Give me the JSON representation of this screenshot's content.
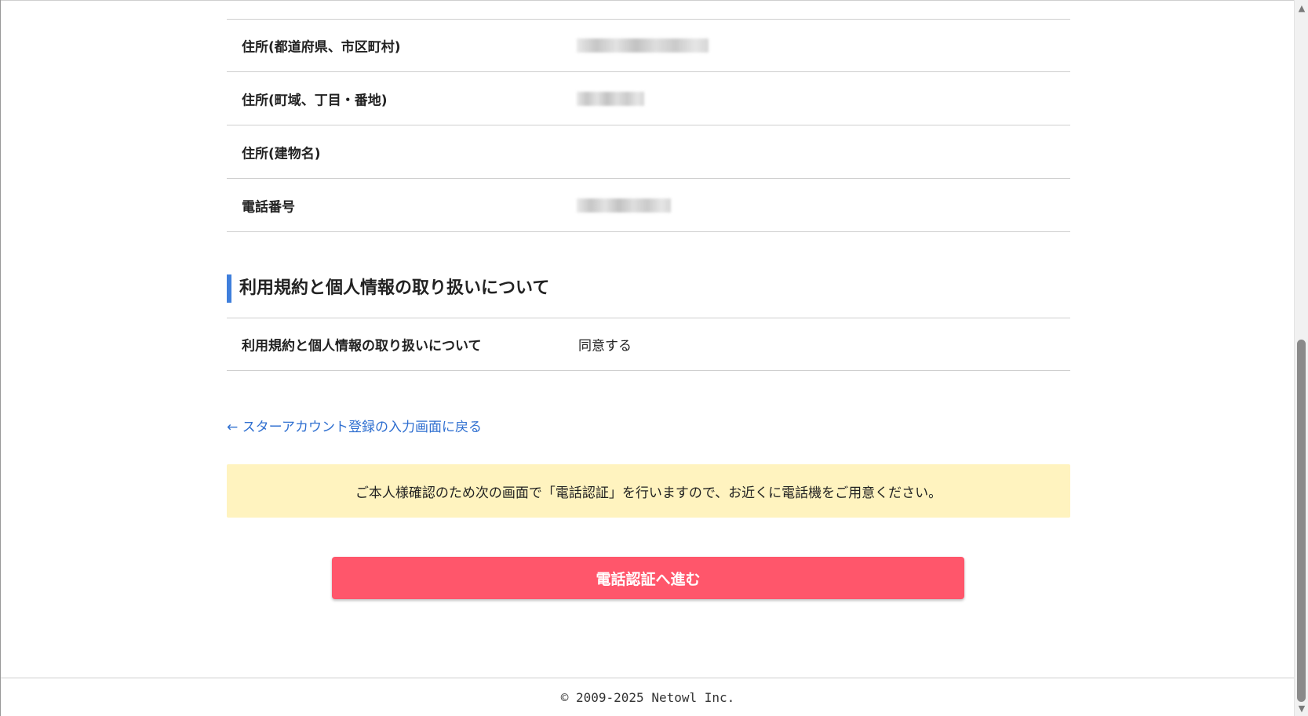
{
  "address_rows": [
    {
      "label": "住所(都道府県、市区町村)",
      "value": "",
      "redacted": true
    },
    {
      "label": "住所(町域、丁目・番地)",
      "value": "",
      "redacted": true
    },
    {
      "label": "住所(建物名)",
      "value": "",
      "redacted": false
    },
    {
      "label": "電話番号",
      "value": "",
      "redacted": true
    }
  ],
  "terms_section": {
    "title": "利用規約と個人情報の取り扱いについて",
    "row": {
      "label": "利用規約と個人情報の取り扱いについて",
      "value": "同意する"
    }
  },
  "back_link": {
    "arrow": "←",
    "label": "スターアカウント登録の入力画面に戻る"
  },
  "notice": "ご本人様確認のため次の画面で「電話認証」を行いますので、お近くに電話機をご用意ください。",
  "submit_label": "電話認証へ進む",
  "footer": "© 2009-2025 Netowl Inc.",
  "colors": {
    "accent_bar": "#3f7fdc",
    "link": "#2f6fd0",
    "notice_bg": "#fff3bf",
    "button": "#ff566b"
  }
}
